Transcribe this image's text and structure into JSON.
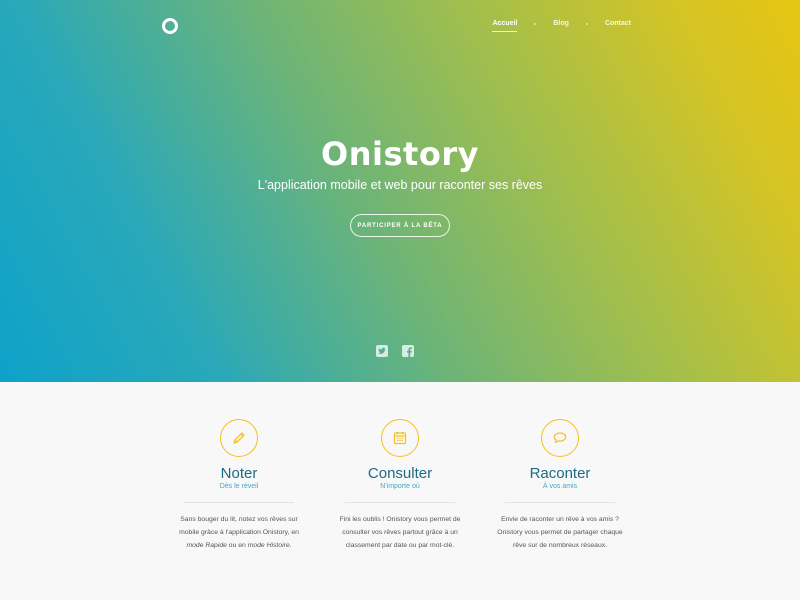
{
  "nav": {
    "items": [
      {
        "label": "Accueil",
        "active": true
      },
      {
        "label": "Blog",
        "active": false
      },
      {
        "label": "Contact",
        "active": false
      }
    ]
  },
  "hero": {
    "title": "Onistory",
    "subtitle": "L'application mobile et web pour raconter ses rêves",
    "cta_label": "PARTICIPER À LA BÊTA",
    "social": [
      "twitter-icon",
      "facebook-icon"
    ]
  },
  "features": [
    {
      "icon": "pencil-icon",
      "title": "Noter",
      "subtitle": "Dès le réveil",
      "text_line1": "Sans bouger du lit, notez vos rêves sur",
      "text_line2": "mobile grâce à l'application Onistory, en",
      "text_em1": "mode Rapide",
      "text_mid": " ou en ",
      "text_em2": "mode Histoire",
      "text_end": "."
    },
    {
      "icon": "calendar-icon",
      "title": "Consulter",
      "subtitle": "N'importe où",
      "text_line1": "Fini les oublis ! Onistory vous permet de",
      "text_line2": "consulter vos rêves partout grâce à un",
      "text_line3": "classement par date ou par mot-clé."
    },
    {
      "icon": "speech-bubble-icon",
      "title": "Raconter",
      "subtitle": "À vos amis",
      "text_line1": "Envie de raconter un rêve à vos amis ?",
      "text_line2": "Onistory vous permet de partager chaque",
      "text_line3": "rêve sur de nombreux réseaux."
    }
  ],
  "colors": {
    "gradient_start": "#0ea2c9",
    "gradient_end": "#e6c512",
    "accent": "#f3c01f",
    "title": "#1d6a86",
    "subtitle": "#47a8c4"
  }
}
